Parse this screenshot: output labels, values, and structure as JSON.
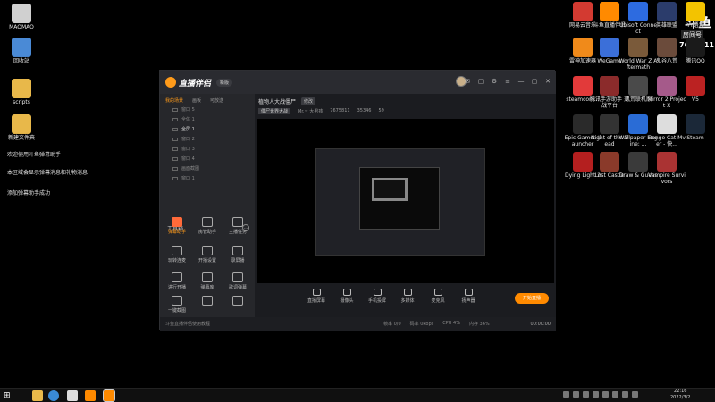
{
  "desktop_left": {
    "icons": [
      {
        "label": "MAOMAO",
        "color": "#dadada"
      },
      {
        "label": "回收站",
        "color": "#4a8ad6"
      },
      {
        "label": "scripts",
        "color": "#e8b84a"
      },
      {
        "label": "新建文件夹",
        "color": "#e8b84a"
      }
    ],
    "notices": [
      "欢迎使用斗鱼弹幕助手",
      "本区域会显示弹幕消息和礼物消息",
      "添加弹幕助手成功"
    ]
  },
  "desktop_right": {
    "icons": [
      {
        "label": "网易云音乐",
        "color": "#d33a31"
      },
      {
        "label": "斗鱼直播伴侣",
        "color": "#ff8a00"
      },
      {
        "label": "Ubisoft Connect",
        "color": "#2d6be0"
      },
      {
        "label": "英雄联盟",
        "color": "#2b3c6b"
      },
      {
        "label": "YY语音",
        "color": "#f3c300"
      },
      {
        "label": "雷神加速器",
        "color": "#f08a1a"
      },
      {
        "label": "WeGame",
        "color": "#3b6fd9"
      },
      {
        "label": "World War Z Aftermath",
        "color": "#7a5a3a"
      },
      {
        "label": "鬼谷八荒",
        "color": "#6b4b3b"
      },
      {
        "label": "腾讯QQ",
        "color": "#1a1a1a"
      },
      {
        "label": "steamcom...",
        "color": "#e23a3a"
      },
      {
        "label": "腾讯手游助手 对战平台",
        "color": "#8b2b2b"
      },
      {
        "label": "饥荒联机版",
        "color": "#4a4a4a"
      },
      {
        "label": "Mirror 2 Project X",
        "color": "#a55a8a"
      },
      {
        "label": "V5",
        "color": "#b22"
      },
      {
        "label": "Epic Games Launcher",
        "color": "#2a2a2a"
      },
      {
        "label": "Night of the Dead",
        "color": "#333"
      },
      {
        "label": "Wallpaper Engine: ...",
        "color": "#2a6cd6"
      },
      {
        "label": "Bongo Cat Mver - 快...",
        "color": "#ddd"
      },
      {
        "label": "Steam",
        "color": "#1b2838"
      },
      {
        "label": "Dying Light 2",
        "color": "#b41f1f"
      },
      {
        "label": "Lost Castle",
        "color": "#8a3a2a"
      },
      {
        "label": "Draw & Guess",
        "color": "#3a3a3a"
      },
      {
        "label": "Vampire Survivors",
        "color": "#a33"
      }
    ],
    "room": {
      "big": "斗鱼",
      "label": "房间号",
      "number": "7675811"
    }
  },
  "app": {
    "brand": "直播伴侣",
    "version": "新版",
    "sidebar": {
      "tabs": [
        "我的场景",
        "画板",
        "可放送"
      ],
      "scenes": [
        "窗口 5",
        "全体 1",
        "全屏 1",
        "窗口 2",
        "窗口 3",
        "窗口 4",
        "画面截图",
        "窗口 1"
      ],
      "tools_title": "工具箱",
      "tools": [
        "弹幕助手",
        "房管助手",
        "主播任务",
        "玩转连麦",
        "开播设置",
        "录屏播",
        "进行开播",
        "弹幕库",
        "歌词弹幕",
        "一键截图",
        "",
        ""
      ]
    },
    "stage": {
      "room_title": "植物人大战僵尸",
      "edit_label": "修改",
      "category": "僵尸世界大战",
      "streamer": "Mr.~ 大男孩",
      "room_id": "7675811",
      "heat": "35346",
      "followers": "59",
      "controls": [
        "直播屏幕",
        "摄像头",
        "手机投屏",
        "多媒体",
        "麦克风",
        "扬声器"
      ],
      "go_live": "开始直播"
    },
    "status": {
      "left": "斗鱼直播伴侣使用教程",
      "stats": [
        "帧率 0/0",
        "码率 0kbps",
        "CPU 4%",
        "内存 36%"
      ],
      "timer": "00:00:00"
    }
  },
  "taskbar": {
    "time": "22:16",
    "date": "2022/3/2"
  }
}
